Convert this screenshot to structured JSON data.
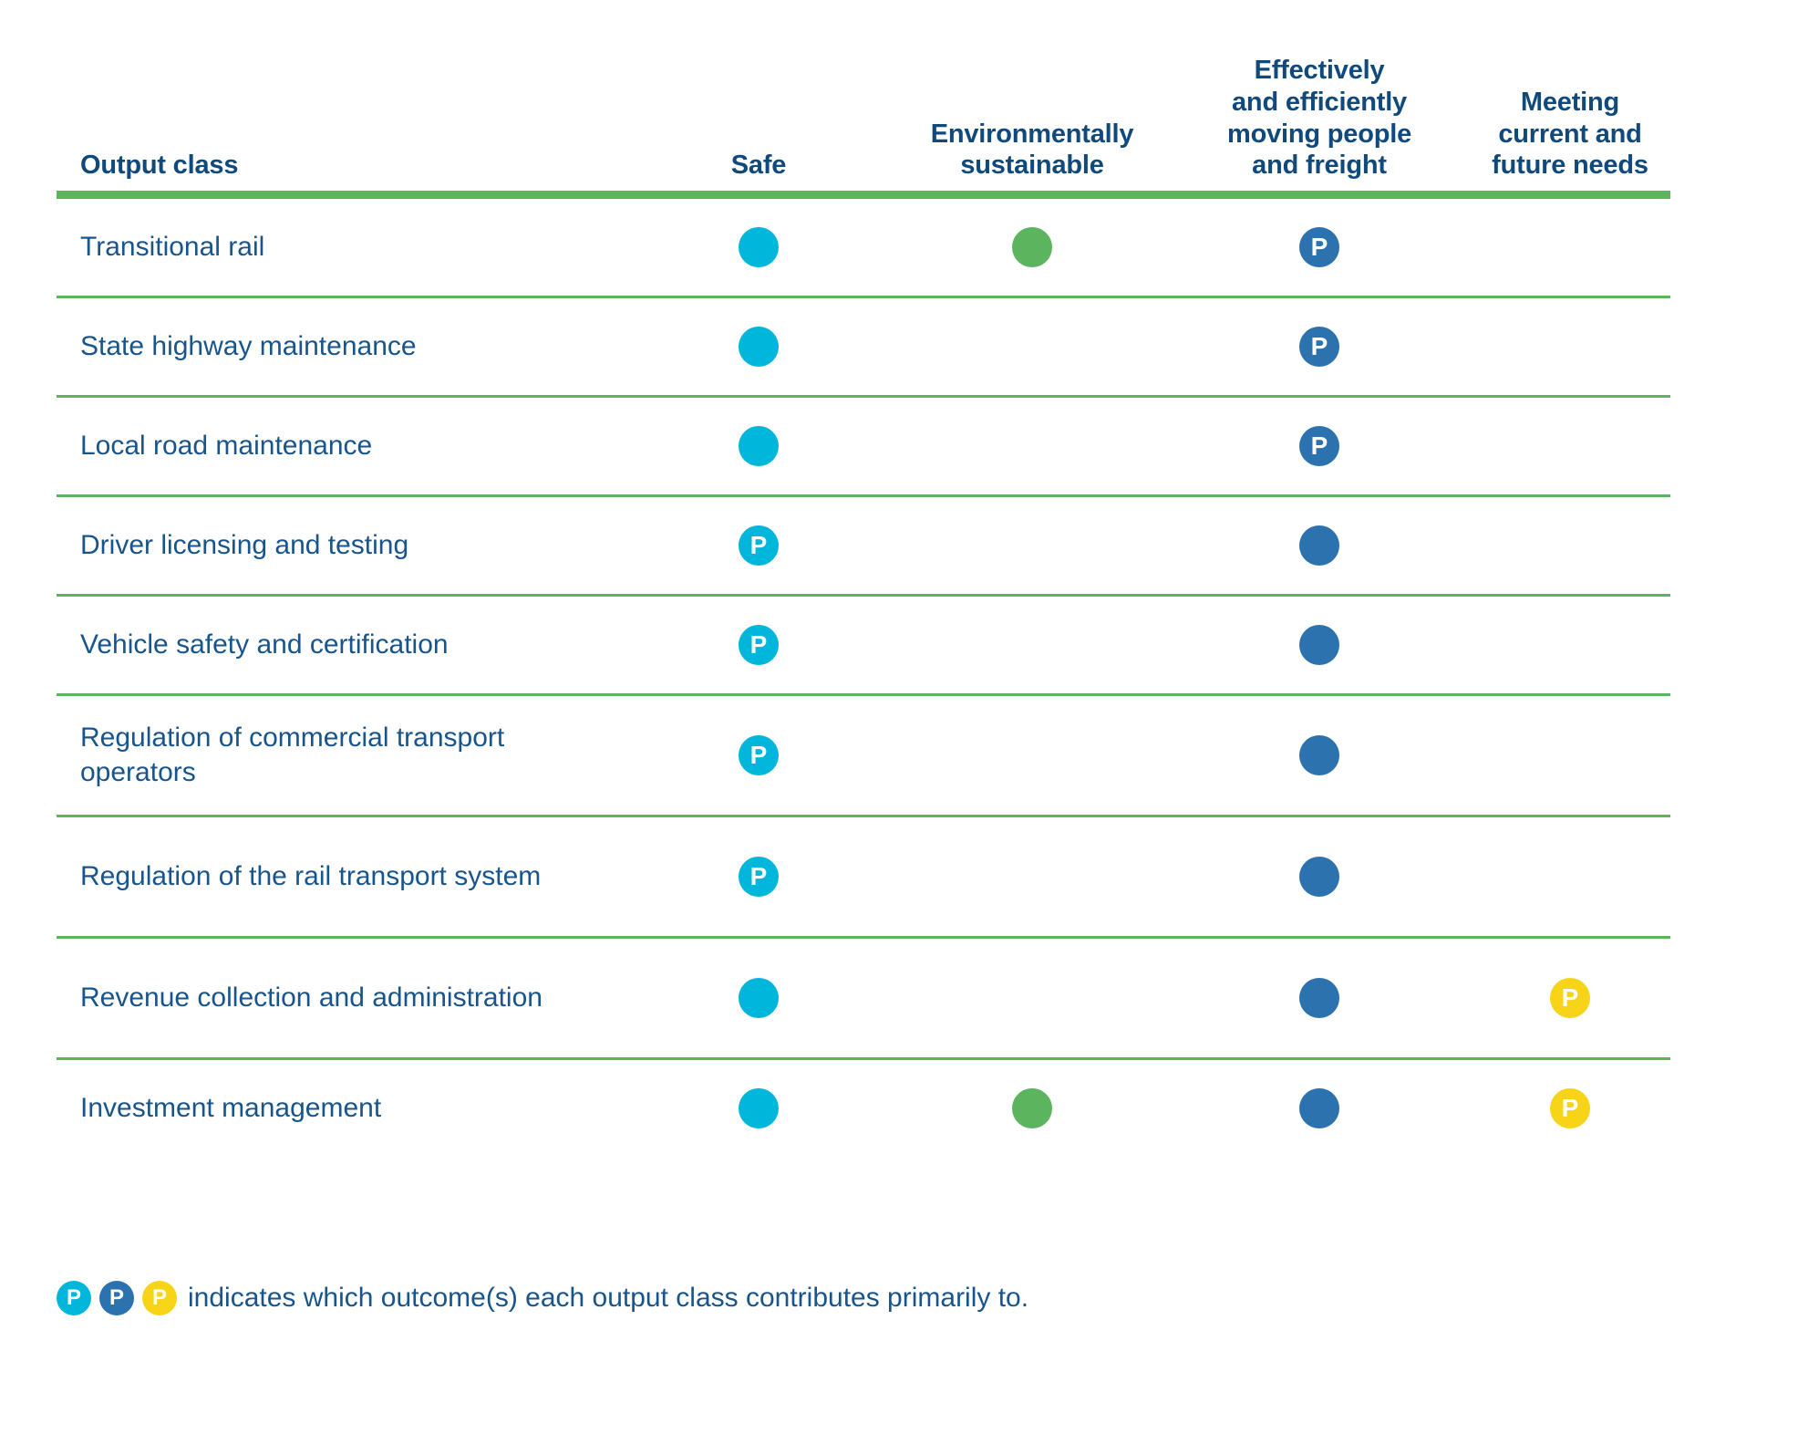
{
  "table": {
    "columns": [
      {
        "key": "label",
        "label": "Output class"
      },
      {
        "key": "safe",
        "label": "Safe"
      },
      {
        "key": "env",
        "label": "Environmentally\nsustainable"
      },
      {
        "key": "eff",
        "label": "Effectively\nand efficiently\nmoving people\nand freight"
      },
      {
        "key": "meet",
        "label": "Meeting\ncurrent and\nfuture needs"
      }
    ],
    "rows": [
      {
        "label": "Transitional rail",
        "safe": {
          "color": "cyan",
          "primary": false
        },
        "env": {
          "color": "green",
          "primary": false
        },
        "eff": {
          "color": "blue",
          "primary": true
        },
        "meet": {
          "color": "none",
          "primary": false
        }
      },
      {
        "label": "State highway maintenance",
        "safe": {
          "color": "cyan",
          "primary": false
        },
        "env": {
          "color": "none",
          "primary": false
        },
        "eff": {
          "color": "blue",
          "primary": true
        },
        "meet": {
          "color": "none",
          "primary": false
        }
      },
      {
        "label": "Local road maintenance",
        "safe": {
          "color": "cyan",
          "primary": false
        },
        "env": {
          "color": "none",
          "primary": false
        },
        "eff": {
          "color": "blue",
          "primary": true
        },
        "meet": {
          "color": "none",
          "primary": false
        }
      },
      {
        "label": "Driver licensing and testing",
        "safe": {
          "color": "cyan",
          "primary": true
        },
        "env": {
          "color": "none",
          "primary": false
        },
        "eff": {
          "color": "blue",
          "primary": false
        },
        "meet": {
          "color": "none",
          "primary": false
        }
      },
      {
        "label": "Vehicle safety and certification",
        "safe": {
          "color": "cyan",
          "primary": true
        },
        "env": {
          "color": "none",
          "primary": false
        },
        "eff": {
          "color": "blue",
          "primary": false
        },
        "meet": {
          "color": "none",
          "primary": false
        }
      },
      {
        "label": "Regulation of commercial transport operators",
        "safe": {
          "color": "cyan",
          "primary": true
        },
        "env": {
          "color": "none",
          "primary": false
        },
        "eff": {
          "color": "blue",
          "primary": false
        },
        "meet": {
          "color": "none",
          "primary": false
        }
      },
      {
        "label": "Regulation of the rail transport system",
        "safe": {
          "color": "cyan",
          "primary": true
        },
        "env": {
          "color": "none",
          "primary": false
        },
        "eff": {
          "color": "blue",
          "primary": false
        },
        "meet": {
          "color": "none",
          "primary": false
        }
      },
      {
        "label": "Revenue collection and administration",
        "safe": {
          "color": "cyan",
          "primary": false
        },
        "env": {
          "color": "none",
          "primary": false
        },
        "eff": {
          "color": "blue",
          "primary": false
        },
        "meet": {
          "color": "yellow",
          "primary": true
        }
      },
      {
        "label": "Investment management",
        "safe": {
          "color": "cyan",
          "primary": false
        },
        "env": {
          "color": "green",
          "primary": false
        },
        "eff": {
          "color": "blue",
          "primary": false
        },
        "meet": {
          "color": "yellow",
          "primary": true
        }
      }
    ]
  },
  "footnote": {
    "badge_letter": "P",
    "badge_colors": [
      "cyan",
      "blue",
      "yellow"
    ],
    "text": "indicates which outcome(s) each output class contributes primarily to."
  },
  "colors": {
    "cyan": "#00b6db",
    "green": "#5cb45f",
    "blue": "#2c72ae",
    "yellow": "#f7d417",
    "header_text": "#10497c",
    "body_text": "#18558c",
    "rule": "#5cb45f",
    "background": "#ffffff"
  }
}
